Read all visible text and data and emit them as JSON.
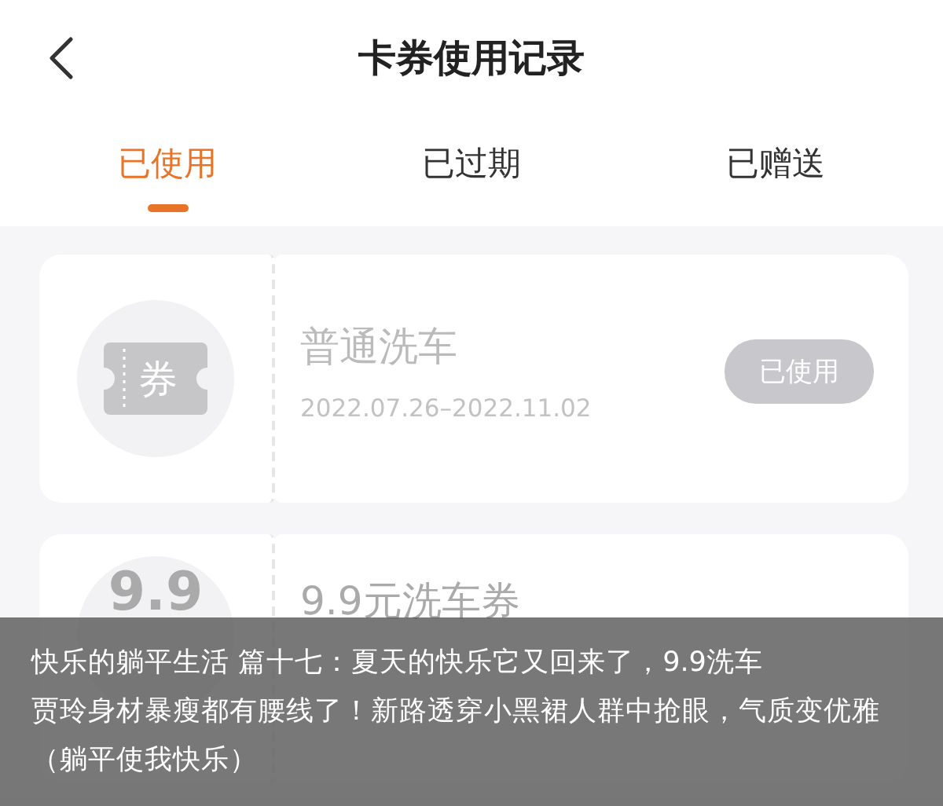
{
  "header": {
    "title": "卡券使用记录"
  },
  "tabs": [
    {
      "label": "已使用",
      "selected": true
    },
    {
      "label": "已过期",
      "selected": false
    },
    {
      "label": "已赠送",
      "selected": false
    }
  ],
  "coupons": [
    {
      "kind": "ticket",
      "badge": "券",
      "name": "普通洗车",
      "validity": "2022.07.26–2022.11.02",
      "status": "已使用"
    },
    {
      "kind": "value",
      "amount": "9.9",
      "name": "9.9元洗车券"
    }
  ],
  "captions": [
    "快乐的躺平生活  篇十七：夏天的快乐它又回来了，9.9洗车",
    "贾玲身材暴瘦都有腰线了！新路透穿小黑裙人群中抢眼，气质变优雅（躺平使我快乐）"
  ]
}
